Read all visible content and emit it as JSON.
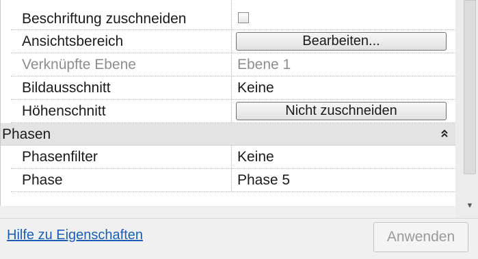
{
  "properties": {
    "rows": [
      {
        "name": "Beschriftung zuschneiden",
        "value_type": "checkbox",
        "checked": false
      },
      {
        "name": "Ansichtsbereich",
        "value_type": "button",
        "value": "Bearbeiten..."
      },
      {
        "name": "Verknüpfte Ebene",
        "value_type": "text",
        "value": "Ebene 1",
        "disabled": true
      },
      {
        "name": "Bildausschnitt",
        "value_type": "text",
        "value": "Keine"
      },
      {
        "name": "Höhenschnitt",
        "value_type": "button",
        "value": "Nicht zuschneiden"
      }
    ],
    "group": {
      "name": "Phasen",
      "collapse_icon": "double-chevron-up-icon",
      "collapse_glyph": "⌃"
    },
    "group_rows": [
      {
        "name": "Phasenfilter",
        "value": "Keine"
      },
      {
        "name": "Phase",
        "value": "Phase 5"
      }
    ]
  },
  "footer": {
    "help_link": "Hilfe zu Eigenschaften",
    "apply_button": "Anwenden"
  },
  "colors": {
    "link": "#1a5fb4",
    "group_header_bg": "#e3e3e3",
    "disabled_text": "#8d8d8d"
  }
}
